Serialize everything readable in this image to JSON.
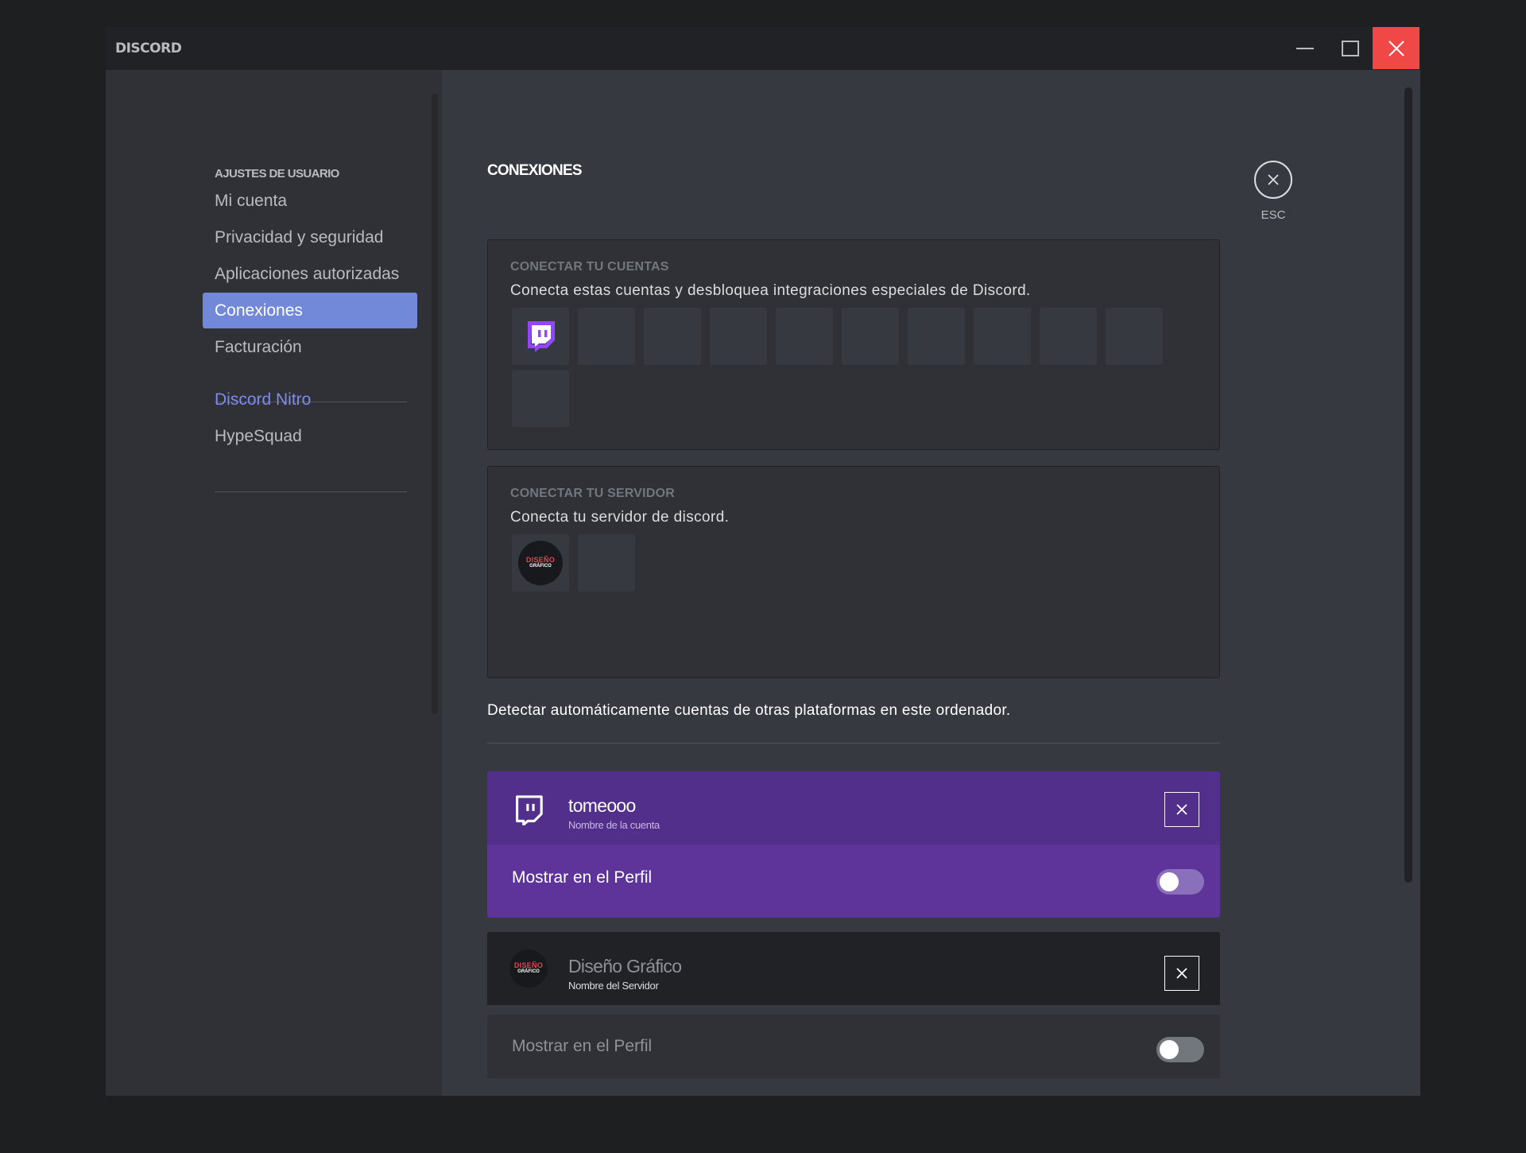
{
  "window": {
    "brand": "DISCORD",
    "controls": {
      "minimize": "minimize-icon",
      "maximize": "maximize-icon",
      "close": "close-icon"
    }
  },
  "sidebar": {
    "header": "AJUSTES DE USUARIO",
    "items": [
      {
        "label": "Mi cuenta",
        "active": false
      },
      {
        "label": "Privacidad y seguridad",
        "active": false
      },
      {
        "label": "Aplicaciones autorizadas",
        "active": false
      },
      {
        "label": "Conexiones",
        "active": true
      },
      {
        "label": "Facturación",
        "active": false
      }
    ],
    "extra_items": [
      {
        "label": "Discord Nitro"
      },
      {
        "label": "HypeSquad"
      }
    ]
  },
  "main": {
    "title": "CONEXIONES",
    "esc_label": "ESC",
    "connect_accounts": {
      "title": "CONECTAR TU CUENTAS",
      "description": "Conecta estas cuentas y desbloquea integraciones especiales de Discord.",
      "first_icon": "twitch-icon"
    },
    "connect_server": {
      "title": "CONECTAR TU SERVIDOR",
      "description": "Conecta tu servidor de discord.",
      "logo_top": "DISEÑO",
      "logo_bottom": "GRÁFICO"
    },
    "detect_text": "Detectar automáticamente cuentas de otras plataformas en este ordenador.",
    "connections": [
      {
        "name": "tomeooo",
        "subtitle": "Nombre de la cuenta",
        "show_label": "Mostrar en el Perfil",
        "show_enabled": false,
        "icon": "twitch-icon"
      },
      {
        "name": "Diseño Gráfico",
        "subtitle": "Nombre del Servidor",
        "show_label": "Mostrar en el Perfil",
        "show_enabled": false,
        "logo_top": "DISEÑO",
        "logo_bottom": "GRÁFICO"
      }
    ]
  },
  "colors": {
    "twitch_header": "#522f8b",
    "twitch_body": "#5e349b",
    "accent": "#7289da",
    "close_red": "#f04747"
  }
}
